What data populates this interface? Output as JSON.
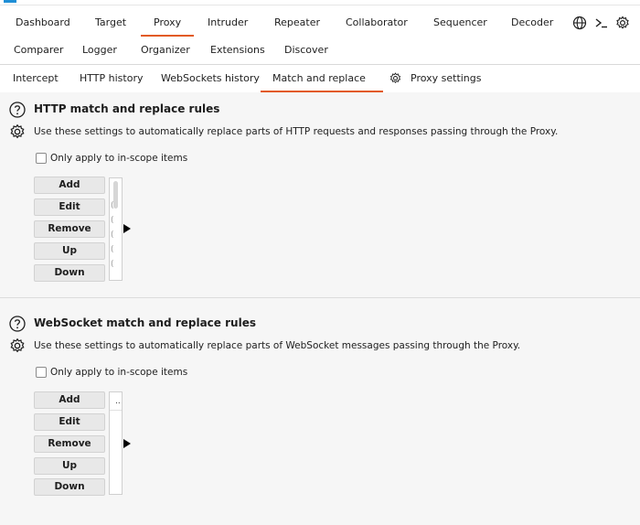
{
  "main_tabs_row1": [
    {
      "label": "Dashboard",
      "active": false
    },
    {
      "label": "Target",
      "active": false
    },
    {
      "label": "Proxy",
      "active": true
    },
    {
      "label": "Intruder",
      "active": false
    },
    {
      "label": "Repeater",
      "active": false
    },
    {
      "label": "Collaborator",
      "active": false
    },
    {
      "label": "Sequencer",
      "active": false
    },
    {
      "label": "Decoder",
      "active": false
    }
  ],
  "main_tabs_row2": [
    {
      "label": "Comparer"
    },
    {
      "label": "Logger"
    },
    {
      "label": "Organizer"
    },
    {
      "label": "Extensions"
    },
    {
      "label": "Discover"
    }
  ],
  "top_icons": [
    "globe-icon",
    "terminal-icon",
    "settings-gear-icon"
  ],
  "proxy_subtabs": [
    {
      "label": "Intercept",
      "active": false
    },
    {
      "label": "HTTP history",
      "active": false
    },
    {
      "label": "WebSockets history",
      "active": false
    },
    {
      "label": "Match and replace",
      "active": true
    },
    {
      "label": "Proxy settings",
      "active": false,
      "icon": "gear-icon"
    }
  ],
  "http_section": {
    "title": "HTTP match and replace rules",
    "description": "Use these settings to automatically replace parts of HTTP requests and responses passing through the Proxy.",
    "checkbox_label": "Only apply to in-scope items",
    "checkbox_checked": false,
    "buttons": [
      "Add",
      "Edit",
      "Remove",
      "Up",
      "Down"
    ]
  },
  "websocket_section": {
    "title": "WebSocket match and replace rules",
    "description": "Use these settings to automatically replace parts of WebSocket messages passing through the Proxy.",
    "checkbox_label": "Only apply to in-scope items",
    "checkbox_checked": false,
    "buttons": [
      "Add",
      "Edit",
      "Remove",
      "Up",
      "Down"
    ],
    "table_header_text": ".."
  },
  "colors": {
    "active_tab_underline": "#e25a1c",
    "background": "#f6f6f6"
  }
}
